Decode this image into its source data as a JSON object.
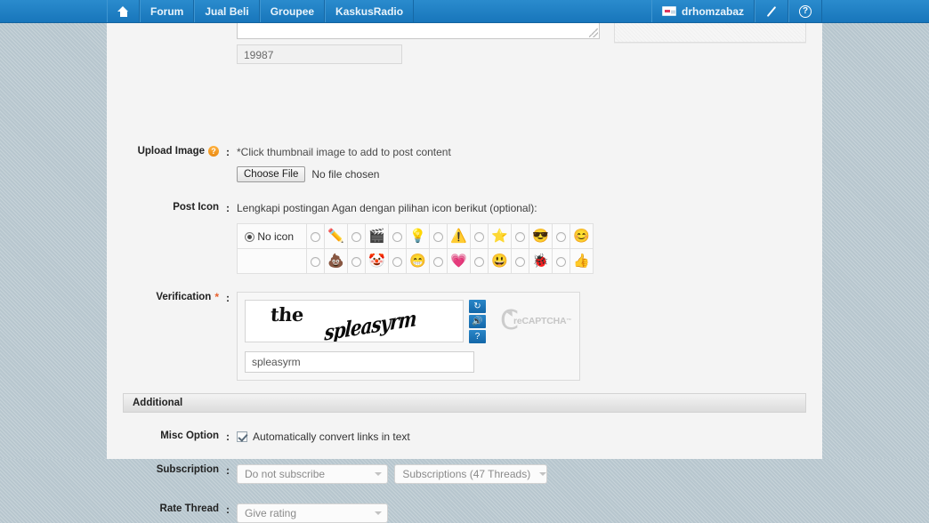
{
  "navbar": {
    "home_icon": "home-icon",
    "items": [
      {
        "label": "Forum"
      },
      {
        "label": "Jual Beli"
      },
      {
        "label": "Groupee"
      },
      {
        "label": "KaskusRadio"
      }
    ],
    "user": {
      "badge_icon": "user-card-icon",
      "name": "drhomzabaz"
    },
    "edit_icon": "pencil-icon",
    "help_icon": "question-icon",
    "help_glyph": "?",
    "brand_color": "#1f7dc0"
  },
  "editor": {
    "char_counter": "19987"
  },
  "upload_image": {
    "label": "Upload Image",
    "help_glyph": "?",
    "colon": ":",
    "hint": "*Click thumbnail image to add to post content",
    "choose_file_label": "Choose File",
    "file_status": "No file chosen"
  },
  "post_icon": {
    "label": "Post Icon",
    "colon": ":",
    "intro": "Lengkapi postingan Agan dengan pilihan icon berikut (optional):",
    "no_icon_label": "No icon",
    "row1": [
      {
        "name": "pencil-icon",
        "glyph": "✏️"
      },
      {
        "name": "clapperboard-icon",
        "glyph": "🎬"
      },
      {
        "name": "lightbulb-icon",
        "glyph": "💡"
      },
      {
        "name": "warning-icon",
        "glyph": "⚠️"
      },
      {
        "name": "star-icon",
        "glyph": "⭐"
      },
      {
        "name": "sunglasses-face-icon",
        "glyph": "😎"
      },
      {
        "name": "smiley-face-icon",
        "glyph": "😊"
      }
    ],
    "row2": [
      {
        "name": "poop-icon",
        "glyph": "💩"
      },
      {
        "name": "clown-face-icon",
        "glyph": "🤡"
      },
      {
        "name": "laughing-face-icon",
        "glyph": "😁"
      },
      {
        "name": "heart-icon",
        "glyph": "💗"
      },
      {
        "name": "blue-face-icon",
        "glyph": "😃"
      },
      {
        "name": "bug-icon",
        "glyph": "🐞"
      },
      {
        "name": "thumbs-up-icon",
        "glyph": "👍"
      }
    ]
  },
  "verification": {
    "label": "Verification",
    "required_mark": "*",
    "colon": ":",
    "captcha_word_1": "the",
    "captcha_word_2": "spleasyrm",
    "refresh_glyph": "↻",
    "audio_glyph": "🔊",
    "help_glyph": "?",
    "logo_c": "C",
    "logo_prefix": "re",
    "logo_text": "CAPTCHA",
    "logo_tm": "™",
    "input_value": "spleasyrm"
  },
  "additional": {
    "section_title": "Additional",
    "misc_option": {
      "label": "Misc Option",
      "colon": ":",
      "checkbox_label": "Automatically convert links in text",
      "checked": true
    },
    "subscription": {
      "label": "Subscription",
      "colon": ":",
      "select_1": "Do not subscribe",
      "select_2": "Subscriptions (47 Threads)"
    },
    "rate_thread": {
      "label": "Rate Thread",
      "colon": ":",
      "select_1": "Give rating"
    }
  }
}
